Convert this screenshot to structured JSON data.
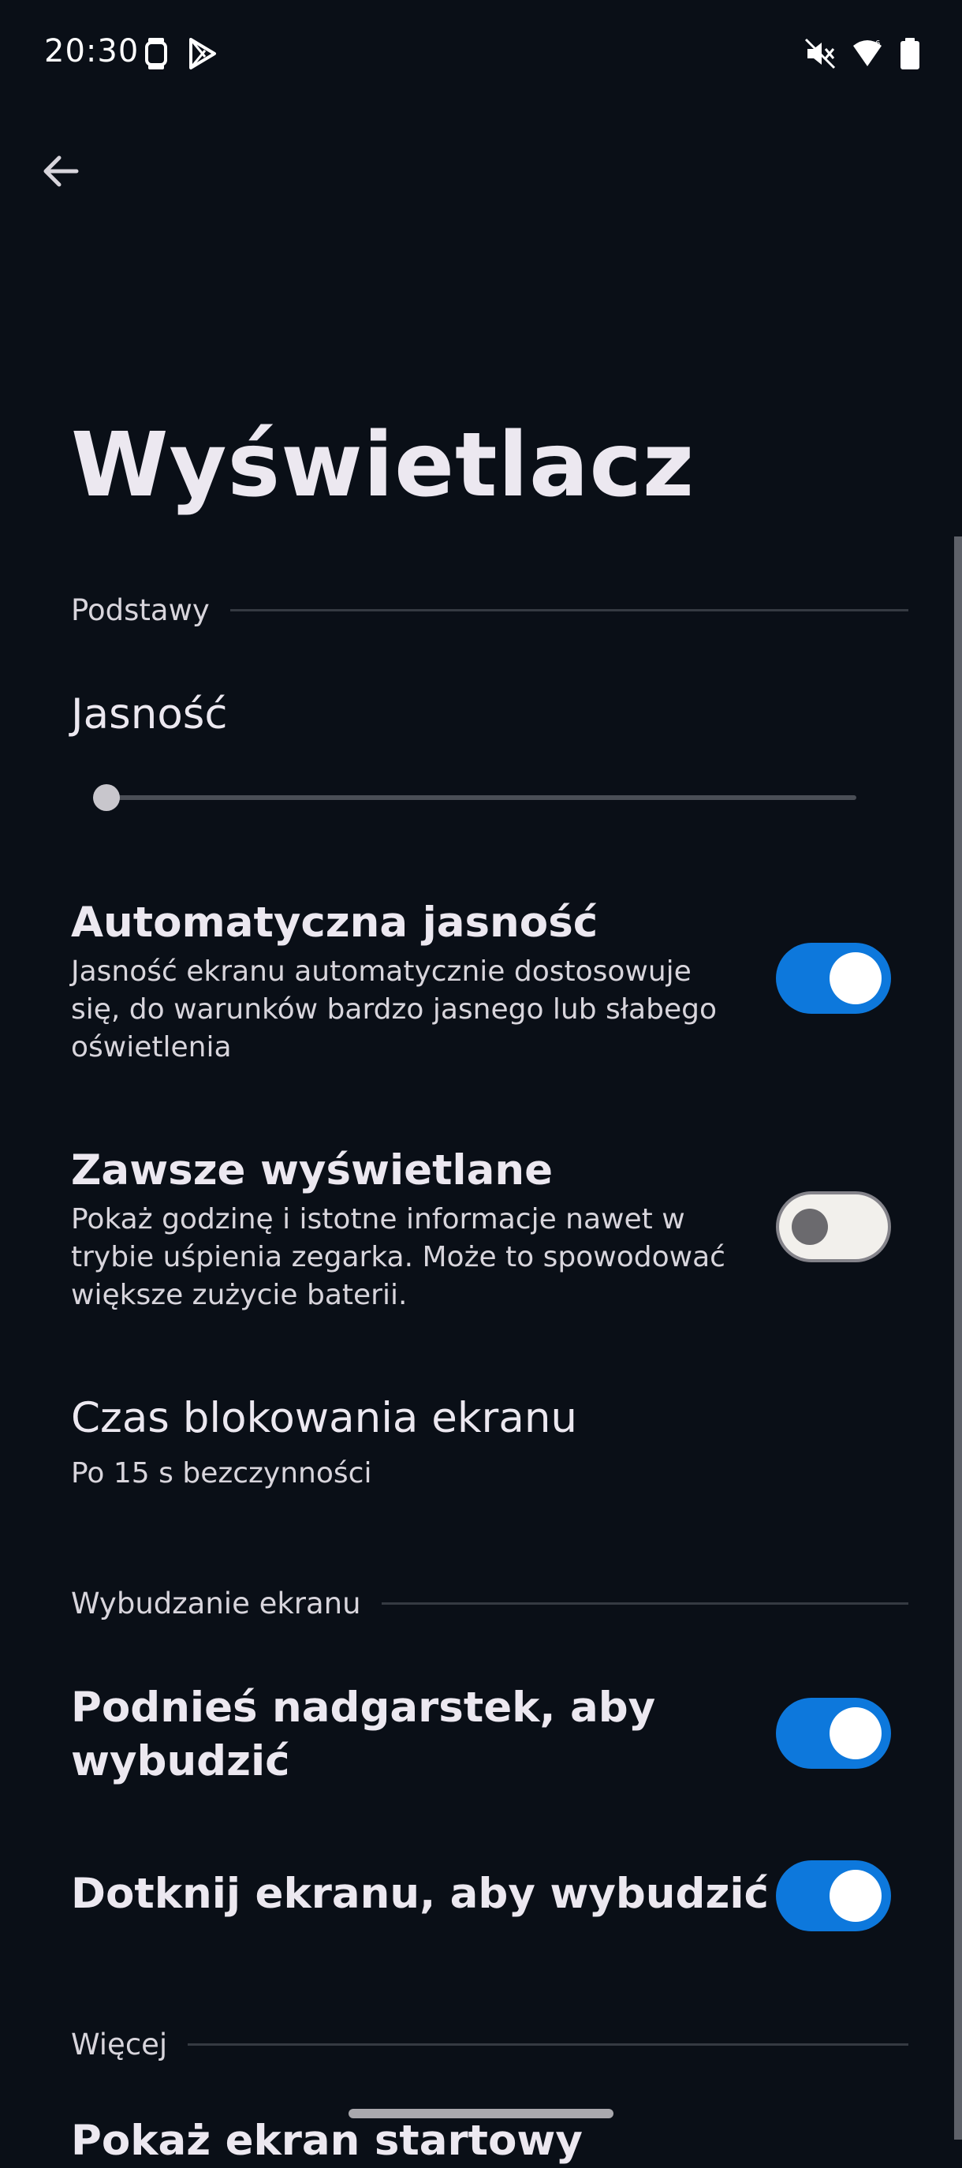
{
  "status_bar": {
    "time": "20:30",
    "left_icons": [
      "watch-icon",
      "play-store-icon"
    ],
    "right_icons": [
      "mute-icon",
      "wifi-icon",
      "battery-icon"
    ]
  },
  "header": {
    "back_icon": "arrow-left-icon",
    "title": "Wyświetlacz"
  },
  "sections": {
    "basics": {
      "label": "Podstawy"
    },
    "wake": {
      "label": "Wybudzanie ekranu"
    },
    "more": {
      "label": "Więcej"
    }
  },
  "brightness": {
    "title": "Jasność",
    "level": 0.0
  },
  "auto_brightness": {
    "title": "Automatyczna jasność",
    "description": "Jasność ekranu automatycznie dostosowuje się, do warunków bardzo jasnego lub słabego oświetlenia",
    "enabled": true
  },
  "always_on": {
    "title": "Zawsze wyświetlane",
    "description": "Pokaż godzinę i istotne informacje nawet w trybie uśpienia zegarka. Może to spowodować większe zużycie baterii.",
    "enabled": false
  },
  "screen_timeout": {
    "title": "Czas blokowania ekranu",
    "value": "Po 15 s bezczynności"
  },
  "raise_to_wake": {
    "title": "Podnieś nadgarstek, aby wybudzić",
    "enabled": true
  },
  "tap_to_wake": {
    "title": "Dotknij ekranu, aby wybudzić",
    "enabled": true
  },
  "next_item_partial": {
    "title": "Pokaż ekran startowy"
  },
  "colors": {
    "background": "#0a0f17",
    "accent": "#0d78dc",
    "text": "#ece8f0"
  }
}
